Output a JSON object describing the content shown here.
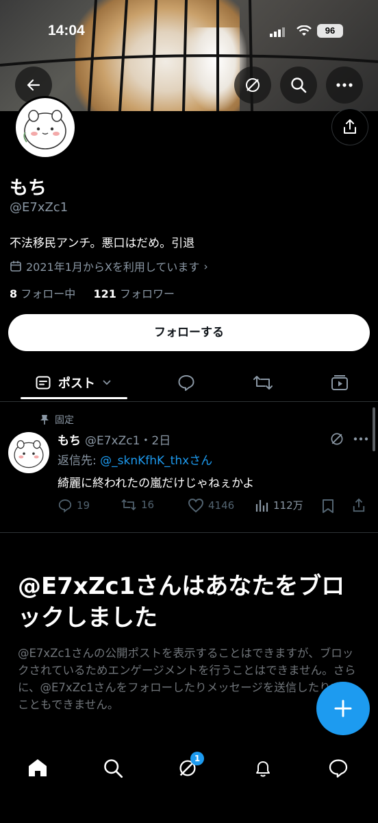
{
  "status_bar": {
    "time": "14:04",
    "battery": "96"
  },
  "profile": {
    "name": "もち",
    "handle": "@E7xZc1",
    "bio": "不法移民アンチ。悪口はだめ。引退",
    "joined": "2021年1月からXを利用しています",
    "following_count": "8",
    "following_label": "フォロー中",
    "followers_count": "121",
    "followers_label": "フォロワー",
    "follow_button": "フォローする"
  },
  "tabs": {
    "posts_label": "ポスト"
  },
  "pinned_post": {
    "pinned_label": "固定",
    "author_name": "もち",
    "meta": "@E7xZc1・2日",
    "reply_prefix": "返信先: ",
    "reply_mention": "@_sknKfhK_thx",
    "reply_suffix": "さん",
    "text": "綺麗に終われたの嵐だけじゃねぇかよ",
    "replies": "19",
    "reposts": "16",
    "likes": "4146",
    "views": "112万"
  },
  "blocked": {
    "title": "@E7xZc1さんはあなたをブロックしました",
    "description": "@E7xZc1さんの公開ポストを表示することはできますが、ブロックされているためエンゲージメントを行うことはできません。さらに、@E7xZc1さんをフォローしたりメッセージを送信したりすることもできません。"
  },
  "nav": {
    "grok_badge": "1"
  },
  "colors": {
    "accent": "#1d9bf0",
    "muted": "#71767b",
    "background": "#000000"
  }
}
